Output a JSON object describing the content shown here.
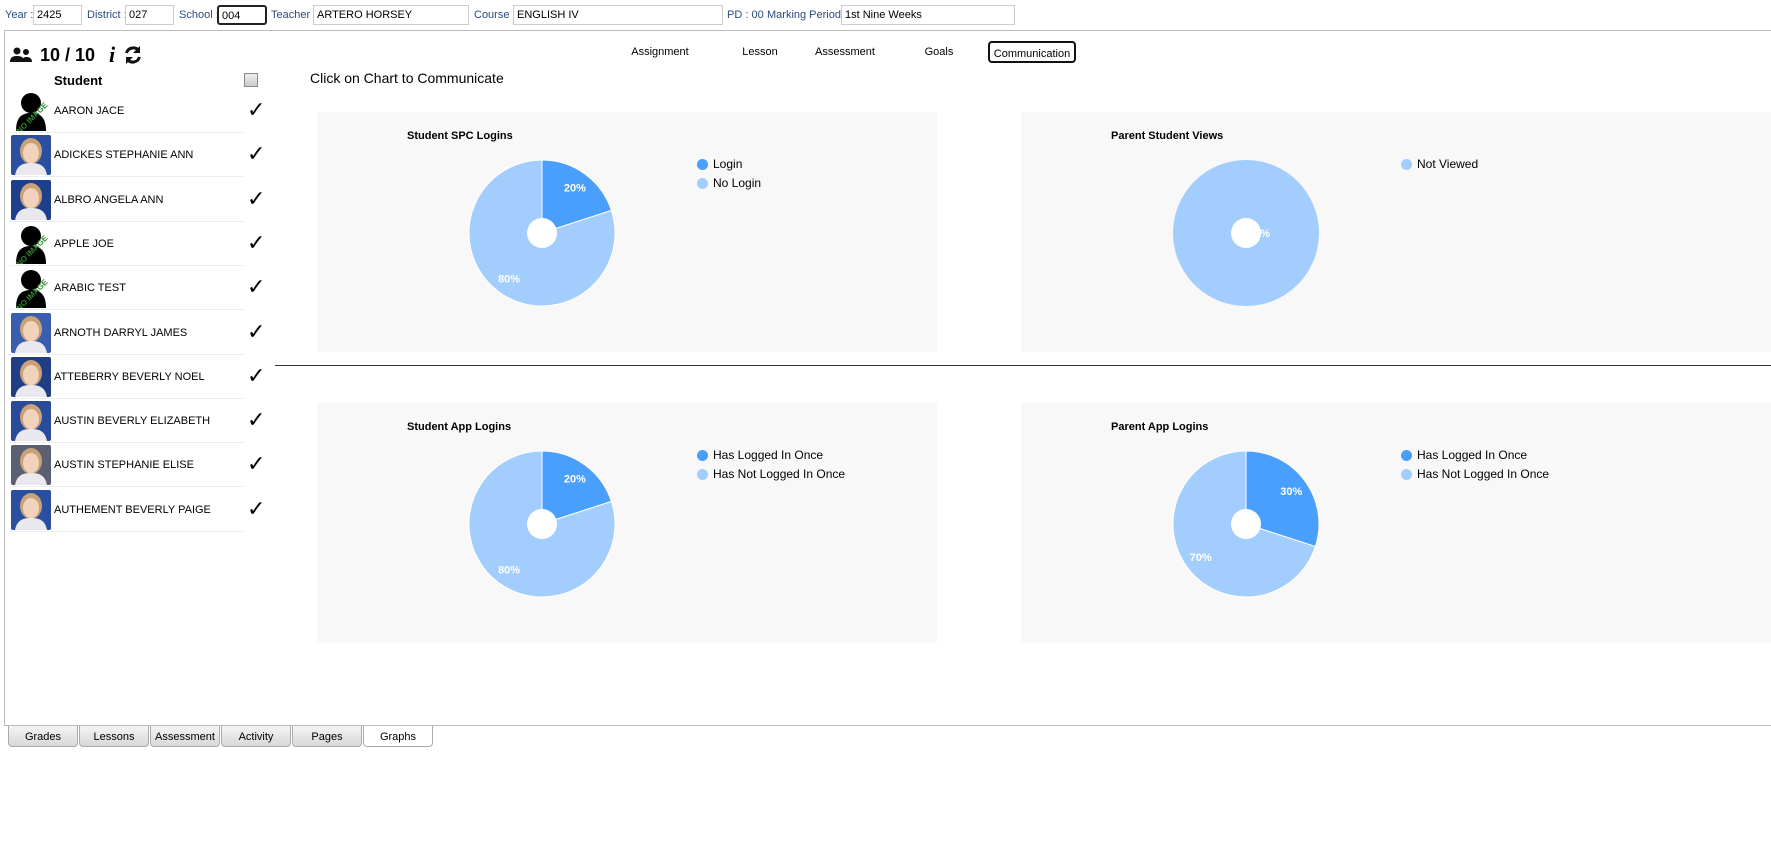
{
  "filters": {
    "year_label": "Year :",
    "year": "2425",
    "district_label": "District :",
    "district": "027",
    "school_label": "School :",
    "school": "004",
    "teacher_label": "Teacher :",
    "teacher": "ARTERO HORSEY",
    "course_label": "Course :",
    "course": "ENGLISH IV",
    "pd_label": "PD : 00",
    "marking_label": "Marking Period :",
    "marking": "1st Nine Weeks"
  },
  "header": {
    "count": "10 / 10",
    "info_icon": "i"
  },
  "list": {
    "column": "Student",
    "students": [
      {
        "name": "AARON JACE",
        "photo": "no-image"
      },
      {
        "name": "ADICKES STEPHANIE ANN",
        "photo": "photo"
      },
      {
        "name": "ALBRO ANGELA ANN",
        "photo": "photo"
      },
      {
        "name": "APPLE JOE",
        "photo": "no-image"
      },
      {
        "name": "ARABIC TEST",
        "photo": "no-image"
      },
      {
        "name": "ARNOTH DARRYL JAMES",
        "photo": "photo"
      },
      {
        "name": "ATTEBERRY BEVERLY NOEL",
        "photo": "photo"
      },
      {
        "name": "AUSTIN BEVERLY ELIZABETH",
        "photo": "photo"
      },
      {
        "name": "AUSTIN STEPHANIE ELISE",
        "photo": "photo"
      },
      {
        "name": "AUTHEMENT BEVERLY PAIGE",
        "photo": "photo"
      }
    ],
    "no_image_text": "NO IMAGE",
    "check": "✓"
  },
  "nav": {
    "tabs": [
      "Assignment",
      "Lesson",
      "Assessment",
      "Goals",
      "Communication"
    ],
    "active": "Communication"
  },
  "hint": "Click on Chart to Communicate",
  "colors": {
    "dark": "#4a9efc",
    "light": "#a3cdfc"
  },
  "chart_data": [
    {
      "type": "pie",
      "title": "Student SPC Logins",
      "categories": [
        "Login",
        "No Login"
      ],
      "values": [
        20,
        80
      ],
      "labels": [
        "20%",
        "80%"
      ]
    },
    {
      "type": "pie",
      "title": "Parent Student Views",
      "categories": [
        "Not Viewed"
      ],
      "values": [
        100
      ],
      "labels": [
        "100%"
      ]
    },
    {
      "type": "pie",
      "title": "Student App Logins",
      "categories": [
        "Has Logged In Once",
        "Has Not Logged In Once"
      ],
      "values": [
        20,
        80
      ],
      "labels": [
        "20%",
        "80%"
      ]
    },
    {
      "type": "pie",
      "title": "Parent App Logins",
      "categories": [
        "Has Logged In Once",
        "Has Not Logged In Once"
      ],
      "values": [
        30,
        70
      ],
      "labels": [
        "30%",
        "70%"
      ]
    }
  ],
  "bottom_tabs": {
    "tabs": [
      "Grades",
      "Lessons",
      "Assessment",
      "Activity",
      "Pages",
      "Graphs"
    ],
    "active": "Graphs"
  }
}
